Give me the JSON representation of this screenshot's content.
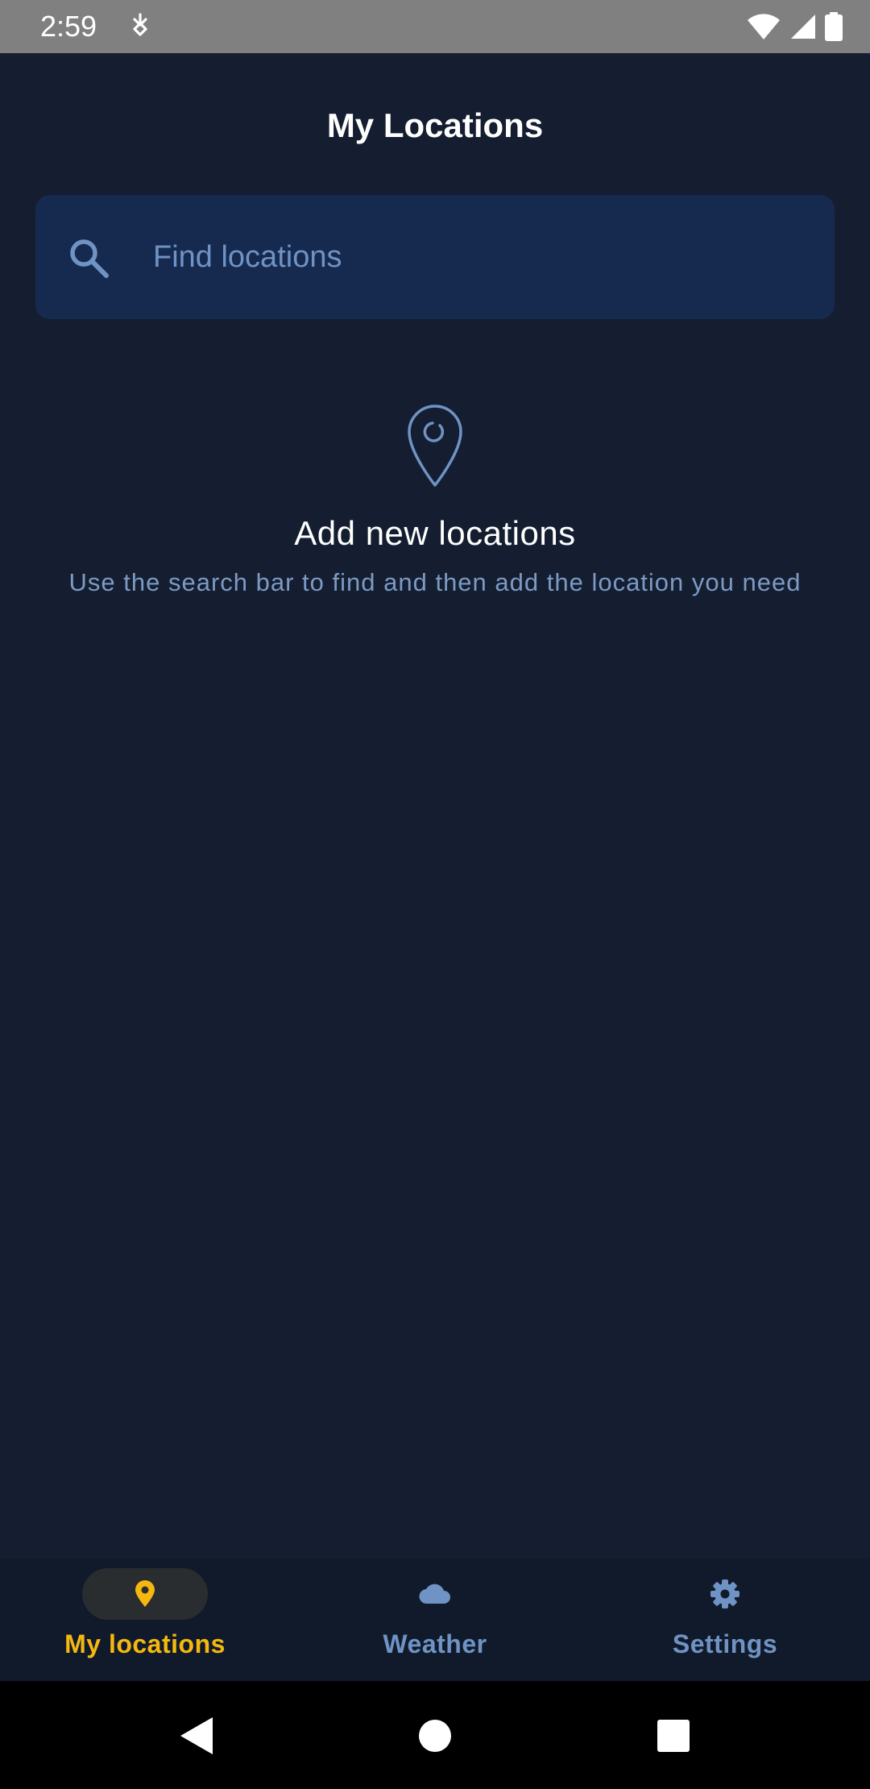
{
  "status_bar": {
    "time": "2:59",
    "left_icon": "download-notification-icon",
    "right_icons": [
      "wifi-icon",
      "cell-signal-icon",
      "battery-icon"
    ]
  },
  "header": {
    "title": "My Locations"
  },
  "search": {
    "placeholder": "Find locations",
    "value": "",
    "icon": "search-icon"
  },
  "empty_state": {
    "icon": "location-pin-icon",
    "title": "Add new locations",
    "subtitle": "Use the search bar to find and then add the location you need"
  },
  "bottom_nav": {
    "items": [
      {
        "label": "My locations",
        "icon": "location-pin-icon",
        "active": true
      },
      {
        "label": "Weather",
        "icon": "cloud-icon",
        "active": false
      },
      {
        "label": "Settings",
        "icon": "gear-icon",
        "active": false
      }
    ]
  },
  "system_nav": {
    "buttons": [
      "back-icon",
      "home-icon",
      "recents-icon"
    ]
  },
  "colors": {
    "background": "#141e30",
    "search_bg": "#162a4f",
    "accent": "#f5b80f",
    "muted": "#6f93c4",
    "nav_bg": "#111a2b"
  }
}
